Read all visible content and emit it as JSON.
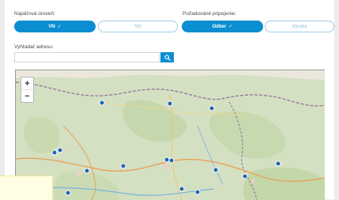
{
  "voltage": {
    "label": "Napäťová úroveň:",
    "options": [
      {
        "label": "VN",
        "check": "✓",
        "selected": true
      },
      {
        "label": "NN",
        "check": "",
        "selected": false
      }
    ]
  },
  "connection": {
    "label": "Požadované pripojenie:",
    "options": [
      {
        "label": "Odber",
        "check": "✓",
        "selected": true
      },
      {
        "label": "Výroba",
        "check": "",
        "selected": false
      }
    ]
  },
  "address": {
    "label": "Vyhľadať adresu:",
    "value": "",
    "placeholder": ""
  },
  "map": {
    "zoom_in": "+",
    "zoom_out": "−"
  },
  "colors": {
    "accent": "#0b8ed1",
    "marker": "#1e66b3"
  },
  "icons": [
    "check-icon",
    "search-icon",
    "map-marker-icon"
  ]
}
